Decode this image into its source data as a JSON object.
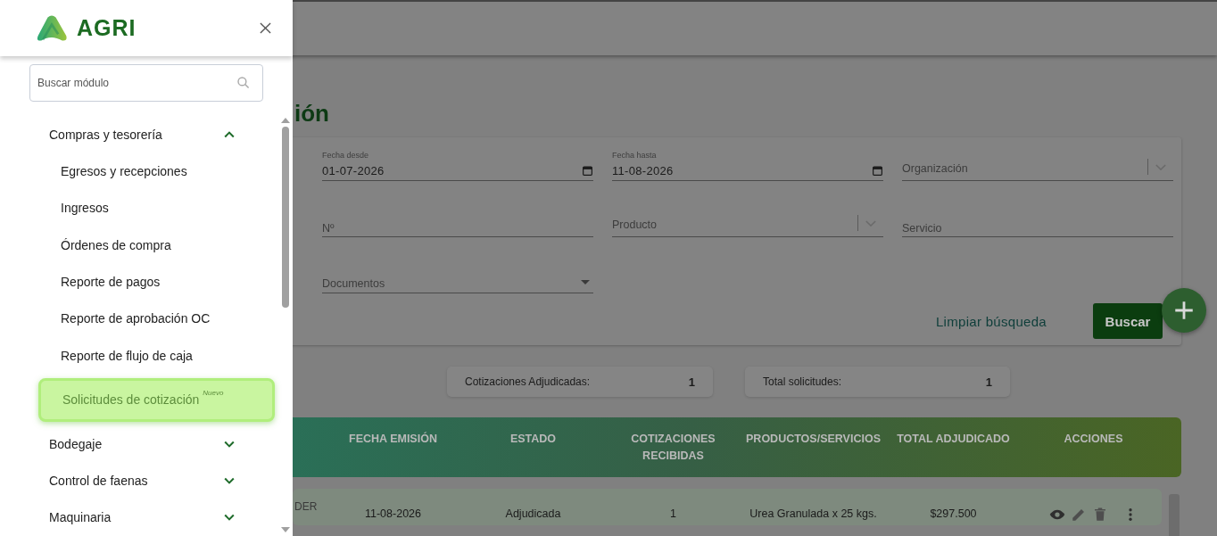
{
  "drawer": {
    "brand": "AGRI",
    "search": {
      "placeholder": "Buscar módulo"
    },
    "groups": [
      {
        "label": "Compras y tesorería",
        "expanded": true,
        "children": [
          {
            "label": "Egresos y recepciones",
            "selected": false
          },
          {
            "label": "Ingresos",
            "selected": false
          },
          {
            "label": "Órdenes de compra",
            "selected": false
          },
          {
            "label": "Reporte de pagos",
            "selected": false
          },
          {
            "label": "Reporte de aprobación OC",
            "selected": false
          },
          {
            "label": "Reporte de flujo de caja",
            "selected": false
          },
          {
            "label": "Solicitudes de cotización",
            "selected": true,
            "badge": "Nuevo"
          }
        ]
      },
      {
        "label": "Bodegaje",
        "expanded": false
      },
      {
        "label": "Control de faenas",
        "expanded": false
      },
      {
        "label": "Maquinaria",
        "expanded": false
      }
    ]
  },
  "main": {
    "title": "ión",
    "filters": [
      {
        "kind": "date",
        "label": "Fecha desde",
        "value": "01-07-2026"
      },
      {
        "kind": "date",
        "label": "Fecha hasta",
        "value": "11-08-2026"
      },
      {
        "kind": "select",
        "placeholder": "Organización"
      },
      {
        "kind": "text",
        "placeholder": "Nº"
      },
      {
        "kind": "select",
        "placeholder": "Producto"
      },
      {
        "kind": "text",
        "placeholder": "Servicio"
      },
      {
        "kind": "dropdown",
        "placeholder": "Documentos"
      }
    ],
    "actions": {
      "clear": "Limpiar búsqueda",
      "search": "Buscar"
    },
    "stats": [
      {
        "label": "Cotizaciones Adjudicadas:",
        "value": "1"
      },
      {
        "label": "Total solicitudes:",
        "value": "1"
      }
    ],
    "table": {
      "columns": [
        "FECHA EMISIÓN",
        "ESTADO",
        "COTIZACIONES RECIBIDAS",
        "PRODUCTOS/SERVICIOS",
        "TOTAL ADJUDICADO",
        "ACCIONES"
      ],
      "rows": [
        {
          "column_1": "DER",
          "cells": [
            "11-08-2026",
            "Adjudicada",
            "1",
            "Urea Granulada x 25 kgs.",
            "$297.500"
          ]
        }
      ]
    }
  }
}
